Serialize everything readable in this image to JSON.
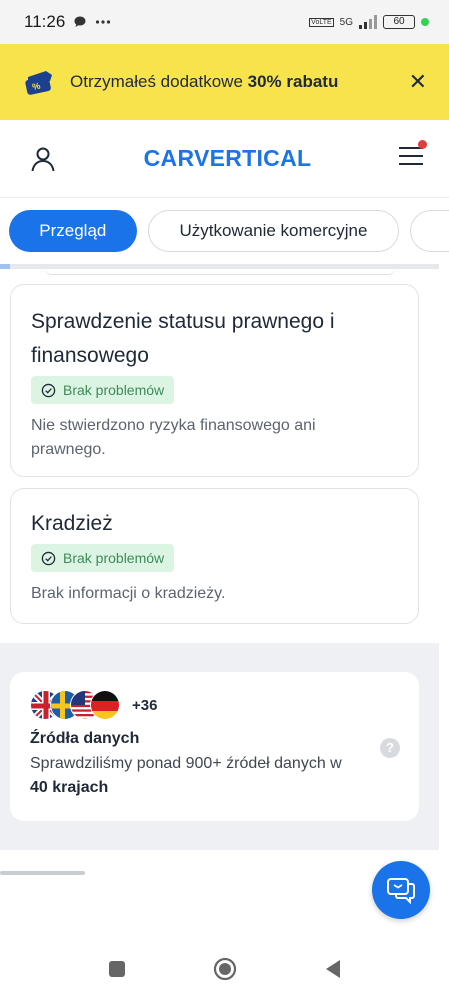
{
  "status_bar": {
    "time": "11:26",
    "network": "5G",
    "battery": "60",
    "volte": "VoLTE"
  },
  "promo": {
    "text_prefix": "Otrzymałeś dodatkowe ",
    "text_bold": "30% rabatu",
    "close_symbol": "✕",
    "background": "#f7e44c"
  },
  "header": {
    "logo": "CARVERTICAL",
    "brand_color": "#1d74e5"
  },
  "tabs": [
    {
      "label": "Przegląd",
      "active": true
    },
    {
      "label": "Użytkowanie komercyjne",
      "active": false
    }
  ],
  "cards": [
    {
      "title": "Sprawdzenie statusu prawnego i finansowego",
      "badge": "Brak problemów",
      "description": "Nie stwierdzono ryzyka finansowego ani prawnego."
    },
    {
      "title": "Kradzież",
      "badge": "Brak problemów",
      "description": "Brak informacji o kradzieży."
    }
  ],
  "sources": {
    "flags": [
      "uk-flag-icon",
      "sweden-flag-icon",
      "usa-flag-icon",
      "germany-flag-icon"
    ],
    "flag_count": "+36",
    "title": "Źródła danych",
    "description_prefix": "Sprawdziliśmy ponad 900+ źródeł danych w ",
    "description_bold": "40 krajach",
    "help_symbol": "?"
  },
  "colors": {
    "accent": "#1a73e8",
    "success_bg": "#dcf5e3",
    "success_text": "#3e8a59"
  }
}
